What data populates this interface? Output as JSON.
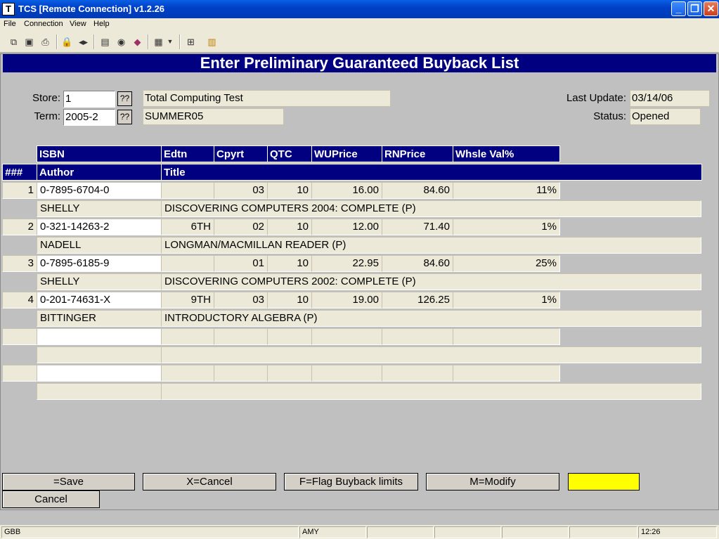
{
  "window": {
    "title": "TCS [Remote Connection]  v1.2.26",
    "app_icon": "T"
  },
  "menu": [
    "File",
    "Connection",
    "View",
    "Help"
  ],
  "toolbar_icons": [
    "copy-icon",
    "save-icon",
    "print-icon",
    "lock-icon",
    "audio-icon",
    "document-icon",
    "globe-icon",
    "book-icon",
    "window-icon",
    "network-icon",
    "chart-icon"
  ],
  "heading": "Enter Preliminary Guaranteed Buyback List",
  "form": {
    "store_label": "Store:",
    "store_value": "1",
    "store_name": "Total Computing Test",
    "term_label": "Term:",
    "term_value": "2005-2",
    "term_name": "SUMMER05",
    "lookup_label": "??",
    "last_update_label": "Last Update:",
    "last_update_value": "03/14/06",
    "status_label": "Status:",
    "status_value": "Opened"
  },
  "grid": {
    "row_header": "###",
    "headers1": [
      "ISBN",
      "Edtn",
      "Cpyrt",
      "QTC",
      "WUPrice",
      "RNPrice",
      "Whsle Val%"
    ],
    "headers2": [
      "Author",
      "Title"
    ],
    "rows": [
      {
        "num": "1",
        "isbn": "0-7895-6704-0",
        "edtn": "",
        "cpyrt": "03",
        "qtc": "10",
        "wuprice": "16.00",
        "rnprice": "84.60",
        "whsle": "11%",
        "author": "SHELLY",
        "title": "DISCOVERING COMPUTERS 2004: COMPLETE (P)"
      },
      {
        "num": "2",
        "isbn": "0-321-14263-2",
        "edtn": "6TH",
        "cpyrt": "02",
        "qtc": "10",
        "wuprice": "12.00",
        "rnprice": "71.40",
        "whsle": "1%",
        "author": "NADELL",
        "title": "LONGMAN/MACMILLAN READER (P)"
      },
      {
        "num": "3",
        "isbn": "0-7895-6185-9",
        "edtn": "",
        "cpyrt": "01",
        "qtc": "10",
        "wuprice": "22.95",
        "rnprice": "84.60",
        "whsle": "25%",
        "author": "SHELLY",
        "title": "DISCOVERING COMPUTERS 2002: COMPLETE (P)"
      },
      {
        "num": "4",
        "isbn": "0-201-74631-X",
        "edtn": "9TH",
        "cpyrt": "03",
        "qtc": "10",
        "wuprice": "19.00",
        "rnprice": "126.25",
        "whsle": "1%",
        "author": "BITTINGER",
        "title": "INTRODUCTORY ALGEBRA (P)"
      },
      {
        "num": "",
        "isbn": "",
        "edtn": "",
        "cpyrt": "",
        "qtc": "",
        "wuprice": "",
        "rnprice": "",
        "whsle": "",
        "author": "",
        "title": ""
      },
      {
        "num": "",
        "isbn": "",
        "edtn": "",
        "cpyrt": "",
        "qtc": "",
        "wuprice": "",
        "rnprice": "",
        "whsle": "",
        "author": "",
        "title": ""
      }
    ]
  },
  "buttons": {
    "save": "=Save",
    "cancel_x": "X=Cancel",
    "flag": "F=Flag Buyback limits",
    "modify": "M=Modify",
    "cancel": "Cancel"
  },
  "indicator_color": "#ffff00",
  "statusbar": {
    "left": "GBB",
    "user": "AMY",
    "time": "12:26"
  }
}
